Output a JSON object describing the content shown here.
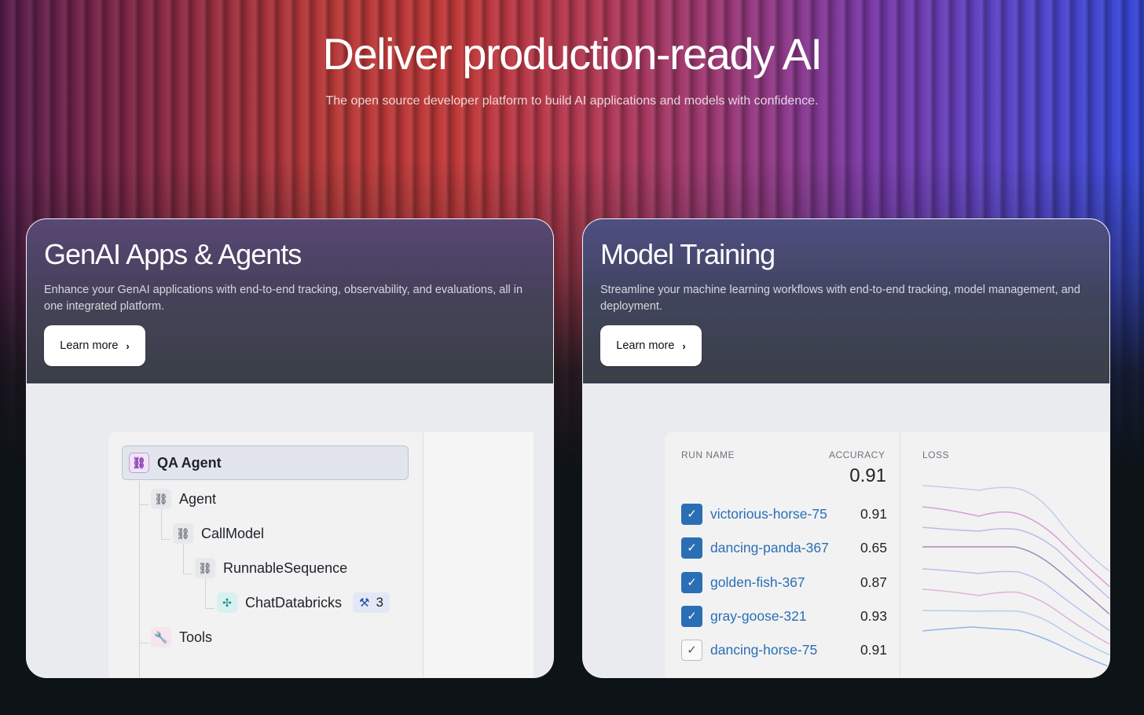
{
  "hero": {
    "title": "Deliver production-ready AI",
    "subtitle": "The open source developer platform to build AI applications and models with confidence."
  },
  "cards": [
    {
      "title": "GenAI Apps & Agents",
      "description": "Enhance your GenAI applications with end-to-end tracking, observability, and evaluations, all in one integrated platform.",
      "button_label": "Learn more",
      "trace": {
        "root": {
          "label": "QA Agent",
          "icon": "link-icon"
        },
        "nodes": [
          {
            "label": "Agent",
            "icon": "link-icon"
          },
          {
            "label": "CallModel",
            "icon": "link-icon"
          },
          {
            "label": "RunnableSequence",
            "icon": "link-icon"
          },
          {
            "label": "ChatDatabricks",
            "icon": "model-icon",
            "badge_icon": "hammer-icon",
            "badge_count": "3"
          },
          {
            "label": "Tools",
            "icon": "wrench-icon"
          }
        ]
      }
    },
    {
      "title": "Model Training",
      "description": "Streamline your machine learning workflows with end-to-end tracking, model management, and deployment.",
      "button_label": "Learn more",
      "runs_table": {
        "headers": {
          "run_name": "RUN NAME",
          "accuracy": "ACCURACY",
          "loss": "LOSS"
        },
        "best_accuracy": "0.91",
        "rows": [
          {
            "name": "victorious-horse-75",
            "accuracy": "0.91",
            "checked": true
          },
          {
            "name": "dancing-panda-367",
            "accuracy": "0.65",
            "checked": true
          },
          {
            "name": "golden-fish-367",
            "accuracy": "0.87",
            "checked": true
          },
          {
            "name": "gray-goose-321",
            "accuracy": "0.93",
            "checked": true
          },
          {
            "name": "dancing-horse-75",
            "accuracy": "0.91",
            "checked": false
          }
        ]
      }
    }
  ],
  "colors": {
    "accent_blue": "#2a6fb5",
    "loss_series": [
      "#9aa8e0",
      "#d58fc8",
      "#b8a8e6",
      "#9b7fb0",
      "#a8b4ea",
      "#d9a2d2",
      "#a9c2ea",
      "#8aaee0"
    ]
  }
}
